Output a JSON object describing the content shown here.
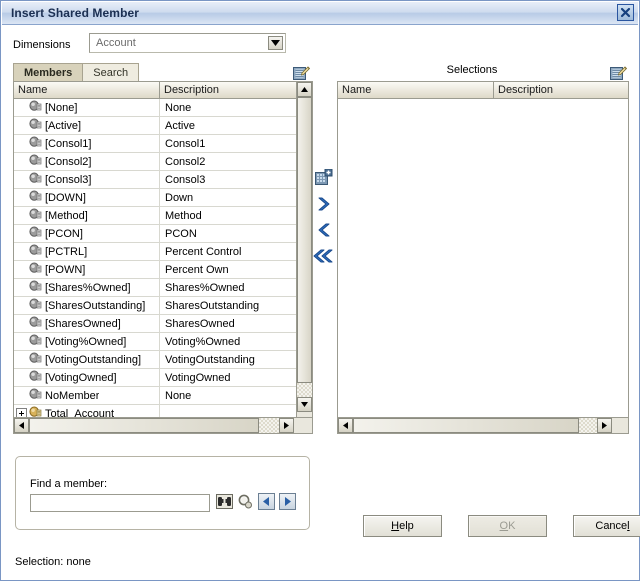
{
  "window": {
    "title": "Insert Shared Member",
    "close_label": "Close"
  },
  "dimensions": {
    "label": "Dimensions",
    "selected": "Account",
    "options": [
      "Account"
    ]
  },
  "tabs": [
    {
      "label": "Members",
      "active": true
    },
    {
      "label": "Search",
      "active": false
    }
  ],
  "members_panel": {
    "properties_icon": "properties-icon",
    "columns": [
      "Name",
      "Description"
    ],
    "rows": [
      {
        "name": "[None]",
        "description": "None",
        "icon": "member-icon",
        "expandable": false
      },
      {
        "name": "[Active]",
        "description": "Active",
        "icon": "member-icon",
        "expandable": false
      },
      {
        "name": "[Consol1]",
        "description": "Consol1",
        "icon": "member-icon",
        "expandable": false
      },
      {
        "name": "[Consol2]",
        "description": "Consol2",
        "icon": "member-icon",
        "expandable": false
      },
      {
        "name": "[Consol3]",
        "description": "Consol3",
        "icon": "member-icon",
        "expandable": false
      },
      {
        "name": "[DOWN]",
        "description": "Down",
        "icon": "member-icon",
        "expandable": false
      },
      {
        "name": "[Method]",
        "description": "Method",
        "icon": "member-icon",
        "expandable": false
      },
      {
        "name": "[PCON]",
        "description": "PCON",
        "icon": "member-icon",
        "expandable": false
      },
      {
        "name": "[PCTRL]",
        "description": "Percent Control",
        "icon": "member-icon",
        "expandable": false
      },
      {
        "name": "[POWN]",
        "description": "Percent Own",
        "icon": "member-icon",
        "expandable": false
      },
      {
        "name": "[Shares%Owned]",
        "description": "Shares%Owned",
        "icon": "member-icon",
        "expandable": false
      },
      {
        "name": "[SharesOutstanding]",
        "description": "SharesOutstanding",
        "icon": "member-icon",
        "expandable": false
      },
      {
        "name": "[SharesOwned]",
        "description": "SharesOwned",
        "icon": "member-icon",
        "expandable": false
      },
      {
        "name": "[Voting%Owned]",
        "description": "Voting%Owned",
        "icon": "member-icon",
        "expandable": false
      },
      {
        "name": "[VotingOutstanding]",
        "description": "VotingOutstanding",
        "icon": "member-icon",
        "expandable": false
      },
      {
        "name": "[VotingOwned]",
        "description": "VotingOwned",
        "icon": "member-icon",
        "expandable": false
      },
      {
        "name": "NoMember",
        "description": "None",
        "icon": "member-icon",
        "expandable": false
      },
      {
        "name": "Total_Account",
        "description": "",
        "icon": "parent-member-icon",
        "expandable": true
      }
    ]
  },
  "transfer": {
    "buttons": [
      {
        "name": "add-selection-button",
        "glyph": "add"
      },
      {
        "name": "move-right-button",
        "glyph": "chevron-right"
      },
      {
        "name": "move-left-button",
        "glyph": "chevron-left"
      },
      {
        "name": "move-all-left-button",
        "glyph": "chevron-double-left"
      }
    ]
  },
  "selections_panel": {
    "title": "Selections",
    "properties_icon": "properties-icon",
    "columns": [
      "Name",
      "Description"
    ],
    "rows": []
  },
  "find": {
    "label": "Find a member:",
    "value": "",
    "placeholder": "",
    "icons": [
      {
        "name": "find-binoculars-icon"
      },
      {
        "name": "find-magnifier-icon"
      },
      {
        "name": "find-previous-icon",
        "glyph": "◀"
      },
      {
        "name": "find-next-icon",
        "glyph": "▶"
      }
    ]
  },
  "buttons": {
    "help": {
      "label": "Help",
      "mnemonic": "H",
      "disabled": false
    },
    "ok": {
      "label": "OK",
      "mnemonic": "O",
      "disabled": true
    },
    "cancel": {
      "label": "Cancel",
      "mnemonic": "l",
      "disabled": false
    }
  },
  "status": {
    "text": "Selection: none"
  },
  "colors": {
    "titlebar_text": "#1b2f52",
    "tab_active_bg": "#d8d2bb",
    "tab_inactive_bg": "#efece0",
    "accent_blue": "#2a5fa5",
    "panel_border": "#9b9b90"
  }
}
